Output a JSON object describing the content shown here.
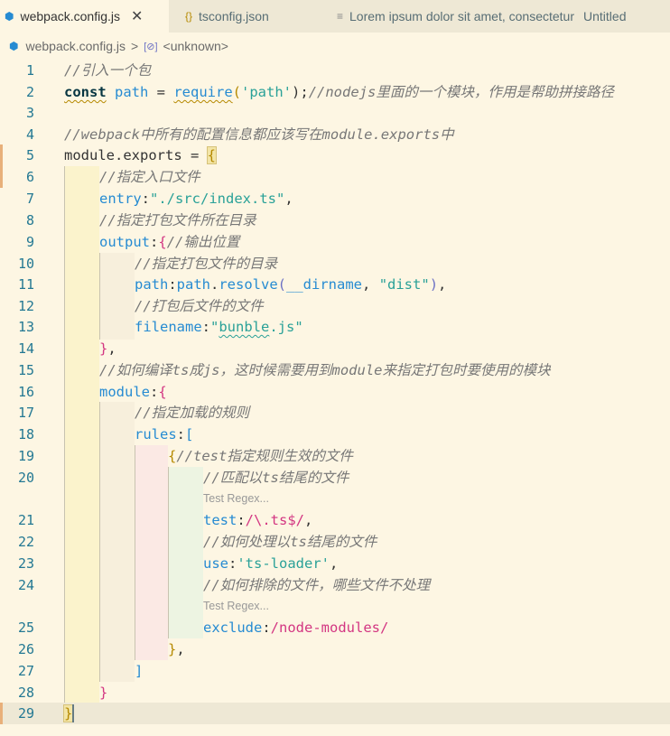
{
  "tabs": [
    {
      "label": "webpack.config.js",
      "icon": "⬢",
      "close": "✕"
    },
    {
      "label": "tsconfig.json",
      "icon": "{}"
    },
    {
      "label": "Lorem ipsum dolor sit amet, consectetur",
      "icon": "≡",
      "extra": "Untitled"
    }
  ],
  "breadcrumb": {
    "file": "webpack.config.js",
    "sep": ">",
    "symbol": "<unknown>"
  },
  "line_numbers": [
    "1",
    "2",
    "3",
    "4",
    "5",
    "6",
    "7",
    "8",
    "9",
    "10",
    "11",
    "12",
    "13",
    "14",
    "15",
    "16",
    "17",
    "18",
    "19",
    "20",
    "21",
    "22",
    "23",
    "24",
    "25",
    "26",
    "27",
    "28",
    "29"
  ],
  "code": {
    "l1_comment": "//引入一个包",
    "l2_const": "const",
    "l2_path": "path",
    "l2_eq": " = ",
    "l2_require": "require",
    "l2_open": "(",
    "l2_arg": "'path'",
    "l2_close": ");",
    "l2_comment": "//nodejs里面的一个模块，作用是帮助拼接路径",
    "l4_comment": "//webpack中所有的配置信息都应该写在module.exports中",
    "l5_module": "module",
    "l5_dot": ".",
    "l5_exports": "exports",
    "l5_eq": " = ",
    "l5_brace": "{",
    "l6_comment": "//指定入口文件",
    "l7_key": "entry",
    "l7_colon": ":",
    "l7_val": "\"./src/index.ts\"",
    "l7_comma": ",",
    "l8_comment": "//指定打包文件所在目录",
    "l9_key": "output",
    "l9_colon": ":",
    "l9_brace": "{",
    "l9_comment": "//输出位置",
    "l10_comment": "//指定打包文件的目录",
    "l11_key": "path",
    "l11_colon": ":",
    "l11_obj": "path",
    "l11_dot": ".",
    "l11_fn": "resolve",
    "l11_open": "(",
    "l11_arg1": "__dirname",
    "l11_sep": ", ",
    "l11_arg2": "\"dist\"",
    "l11_close": ")",
    "l11_comma": ",",
    "l12_comment": "//打包后文件的文件",
    "l13_key": "filename",
    "l13_colon": ":",
    "l13_q1": "\"",
    "l13_val": "bunble",
    "l13_rest": ".js\"",
    "l14_brace": "}",
    "l14_comma": ",",
    "l15_comment": "//如何编译ts成js，这时候需要用到module来指定打包时要使用的模块",
    "l16_key": "module",
    "l16_colon": ":",
    "l16_brace": "{",
    "l17_comment": "//指定加载的规则",
    "l18_key": "rules",
    "l18_colon": ":",
    "l18_bracket": "[",
    "l19_brace": "{",
    "l19_comment": "//test指定规则生效的文件",
    "l20_comment": "//匹配以ts结尾的文件",
    "hint1": "Test Regex...",
    "l21_key": "test",
    "l21_colon": ":",
    "l21_rx": "/\\.ts$/",
    "l21_comma": ",",
    "l22_comment": "//如何处理以ts结尾的文件",
    "l23_key": "use",
    "l23_colon": ":",
    "l23_val": "'ts-loader'",
    "l23_comma": ",",
    "l24_comment": "//如何排除的文件，哪些文件不处理",
    "hint2": "Test Regex...",
    "l25_key": "exclude",
    "l25_colon": ":",
    "l25_rx": "/node-modules/",
    "l26_brace": "}",
    "l26_comma": ",",
    "l27_bracket": "]",
    "l28_brace": "}",
    "l29_brace": "}"
  }
}
